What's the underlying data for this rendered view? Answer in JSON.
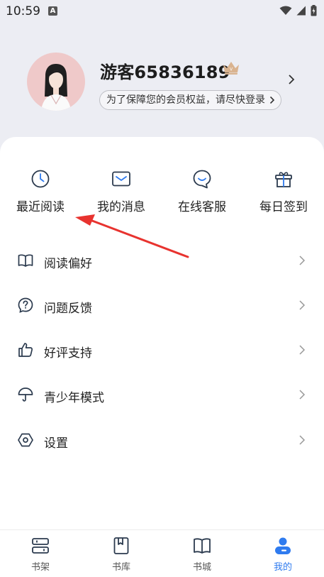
{
  "status": {
    "time": "10:59",
    "badge": "A"
  },
  "profile": {
    "username": "游客65836189",
    "login_prompt": "为了保障您的会员权益，请尽快登录"
  },
  "quick_actions": [
    {
      "label": "最近阅读",
      "icon": "clock-icon"
    },
    {
      "label": "我的消息",
      "icon": "mail-icon"
    },
    {
      "label": "在线客服",
      "icon": "chat-smile-icon"
    },
    {
      "label": "每日签到",
      "icon": "gift-icon"
    }
  ],
  "menu": [
    {
      "label": "阅读偏好",
      "icon": "book-open-icon"
    },
    {
      "label": "问题反馈",
      "icon": "question-icon"
    },
    {
      "label": "好评支持",
      "icon": "thumbs-up-icon"
    },
    {
      "label": "青少年模式",
      "icon": "umbrella-icon"
    },
    {
      "label": "设置",
      "icon": "settings-icon"
    }
  ],
  "tabs": [
    {
      "label": "书架",
      "icon": "shelf-icon"
    },
    {
      "label": "书库",
      "icon": "library-icon"
    },
    {
      "label": "书城",
      "icon": "bookstore-icon"
    },
    {
      "label": "我的",
      "icon": "profile-icon",
      "active": true
    }
  ],
  "colors": {
    "accent": "#2f7bef",
    "arrow": "#e8332f",
    "background": "#ecedf3",
    "icon": "#2b3a4e"
  }
}
